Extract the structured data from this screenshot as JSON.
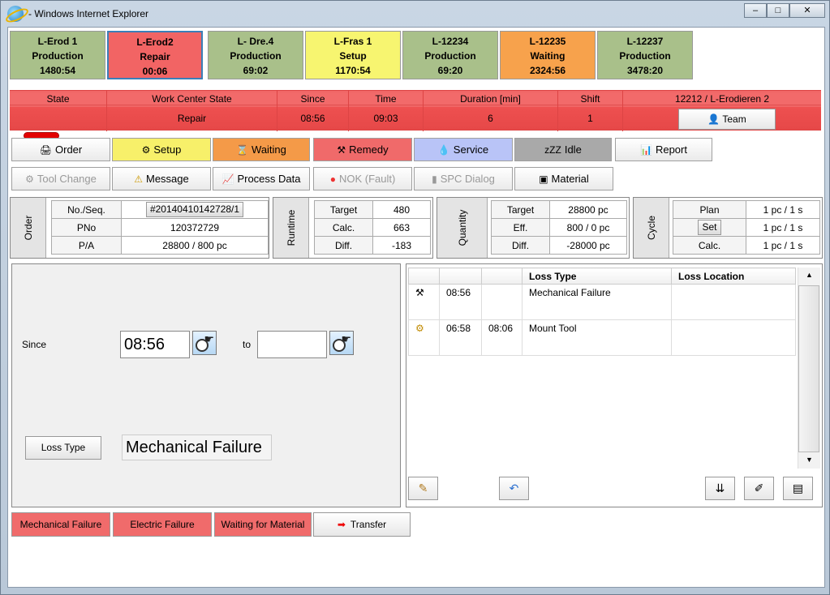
{
  "window": {
    "title": "- Windows Internet Explorer",
    "min": "–",
    "max": "□",
    "close": "✕"
  },
  "work_centers": [
    {
      "name": "L-Erod 1",
      "state": "Production",
      "time": "1480:54",
      "color": "#a9c08a"
    },
    {
      "name": "L-Erod2",
      "state": "Repair",
      "time": "00:06",
      "color": "#f26464"
    },
    {
      "name": "L- Dre.4",
      "state": "Production",
      "time": "69:02",
      "color": "#a9c08a"
    },
    {
      "name": "L-Fras 1",
      "state": "Setup",
      "time": "1170:54",
      "color": "#f7f570"
    },
    {
      "name": "L-12234",
      "state": "Production",
      "time": "69:20",
      "color": "#a9c08a"
    },
    {
      "name": "L-12235",
      "state": "Waiting",
      "time": "2324:56",
      "color": "#f7a24c"
    },
    {
      "name": "L-12237",
      "state": "Production",
      "time": "3478:20",
      "color": "#a9c08a"
    }
  ],
  "status": {
    "headers": {
      "state": "State",
      "wcstate": "Work Center State",
      "since": "Since",
      "time": "Time",
      "duration": "Duration [min]",
      "shift": "Shift",
      "team_title": "12212  / L-Erodieren 2"
    },
    "values": {
      "wcstate": "Repair",
      "since": "08:56",
      "time": "09:03",
      "duration": "6",
      "shift": "1"
    },
    "team_label": "Team"
  },
  "actions_row1": [
    {
      "label": "Order",
      "icon": "printer-icon",
      "glyph": "🖨",
      "bg": "#ffffff"
    },
    {
      "label": "Setup",
      "icon": "setup-icon",
      "glyph": "⚙",
      "bg": "#f7f06a"
    },
    {
      "label": "Waiting",
      "icon": "waiting-icon",
      "glyph": "⌛",
      "bg": "#f49a48"
    },
    {
      "label": "Remedy",
      "icon": "tools-icon",
      "glyph": "⚒",
      "bg": "#f06a6a"
    },
    {
      "label": "Service",
      "icon": "oil-drop-icon",
      "glyph": "💧",
      "bg": "#b9c4f7"
    },
    {
      "label": "Idle",
      "icon": "zzz-icon",
      "glyph": "zZZ",
      "bg": "#a9a9a9"
    },
    {
      "label": "Report",
      "icon": "report-icon",
      "glyph": "📊",
      "bg": "#ffffff"
    }
  ],
  "actions_row2": [
    {
      "label": "Tool Change",
      "icon": "tool-change-icon",
      "glyph": "⚙",
      "disabled": true
    },
    {
      "label": "Message",
      "icon": "warning-icon",
      "glyph": "⚠",
      "disabled": false
    },
    {
      "label": "Process Data",
      "icon": "chart-icon",
      "glyph": "📈",
      "disabled": false
    },
    {
      "label": "NOK (Fault)",
      "icon": "nok-icon",
      "glyph": "●",
      "disabled": true
    },
    {
      "label": "SPC Dialog",
      "icon": "spc-icon",
      "glyph": "▮",
      "disabled": true
    },
    {
      "label": "Material",
      "icon": "material-icon",
      "glyph": "▣",
      "disabled": false
    }
  ],
  "order": {
    "label": "Order",
    "rows": [
      {
        "k": "No./Seq.",
        "v": "#20140410142728/1"
      },
      {
        "k": "PNo",
        "v": "120372729"
      },
      {
        "k": "P/A",
        "v": "28800 / 800 pc"
      }
    ]
  },
  "runtime": {
    "label": "Runtime",
    "rows": [
      {
        "k": "Target",
        "v": "480"
      },
      {
        "k": "Calc.",
        "v": "663"
      },
      {
        "k": "Diff.",
        "v": "-183"
      }
    ]
  },
  "quantity": {
    "label": "Quantity",
    "rows": [
      {
        "k": "Target",
        "v": "28800 pc"
      },
      {
        "k": "Eff.",
        "v": "800 / 0 pc"
      },
      {
        "k": "Diff.",
        "v": "-28000 pc"
      }
    ]
  },
  "cycle": {
    "label": "Cycle",
    "rows": [
      {
        "k": "Plan",
        "v": "1 pc  / 1 s"
      },
      {
        "k": "Set",
        "v": "1 pc  / 1 s"
      },
      {
        "k": "Calc.",
        "v": "1 pc  / 1 s"
      }
    ]
  },
  "loss_form": {
    "since_label": "Since",
    "since_value": "08:56",
    "to_label": "to",
    "to_value": "",
    "loss_type_button": "Loss Type",
    "loss_type_value": "Mechanical Failure"
  },
  "loss_table": {
    "headers": [
      "",
      "",
      "",
      "Loss Type",
      "Loss Location"
    ],
    "rows": [
      {
        "icon": "hammer-icon",
        "glyph": "⚒",
        "from": "08:56",
        "to": "",
        "type": "Mechanical Failure",
        "location": ""
      },
      {
        "icon": "setup-icon",
        "glyph": "⚙",
        "from": "06:58",
        "to": "08:06",
        "type": "Mount Tool",
        "location": ""
      }
    ]
  },
  "bottom_buttons": [
    {
      "label": "Mechanical Failure",
      "red": true
    },
    {
      "label": "Electric Failure",
      "red": true
    },
    {
      "label": "Waiting for Material",
      "red": true
    },
    {
      "label": "Transfer",
      "red": false,
      "glyph": "➡"
    }
  ]
}
